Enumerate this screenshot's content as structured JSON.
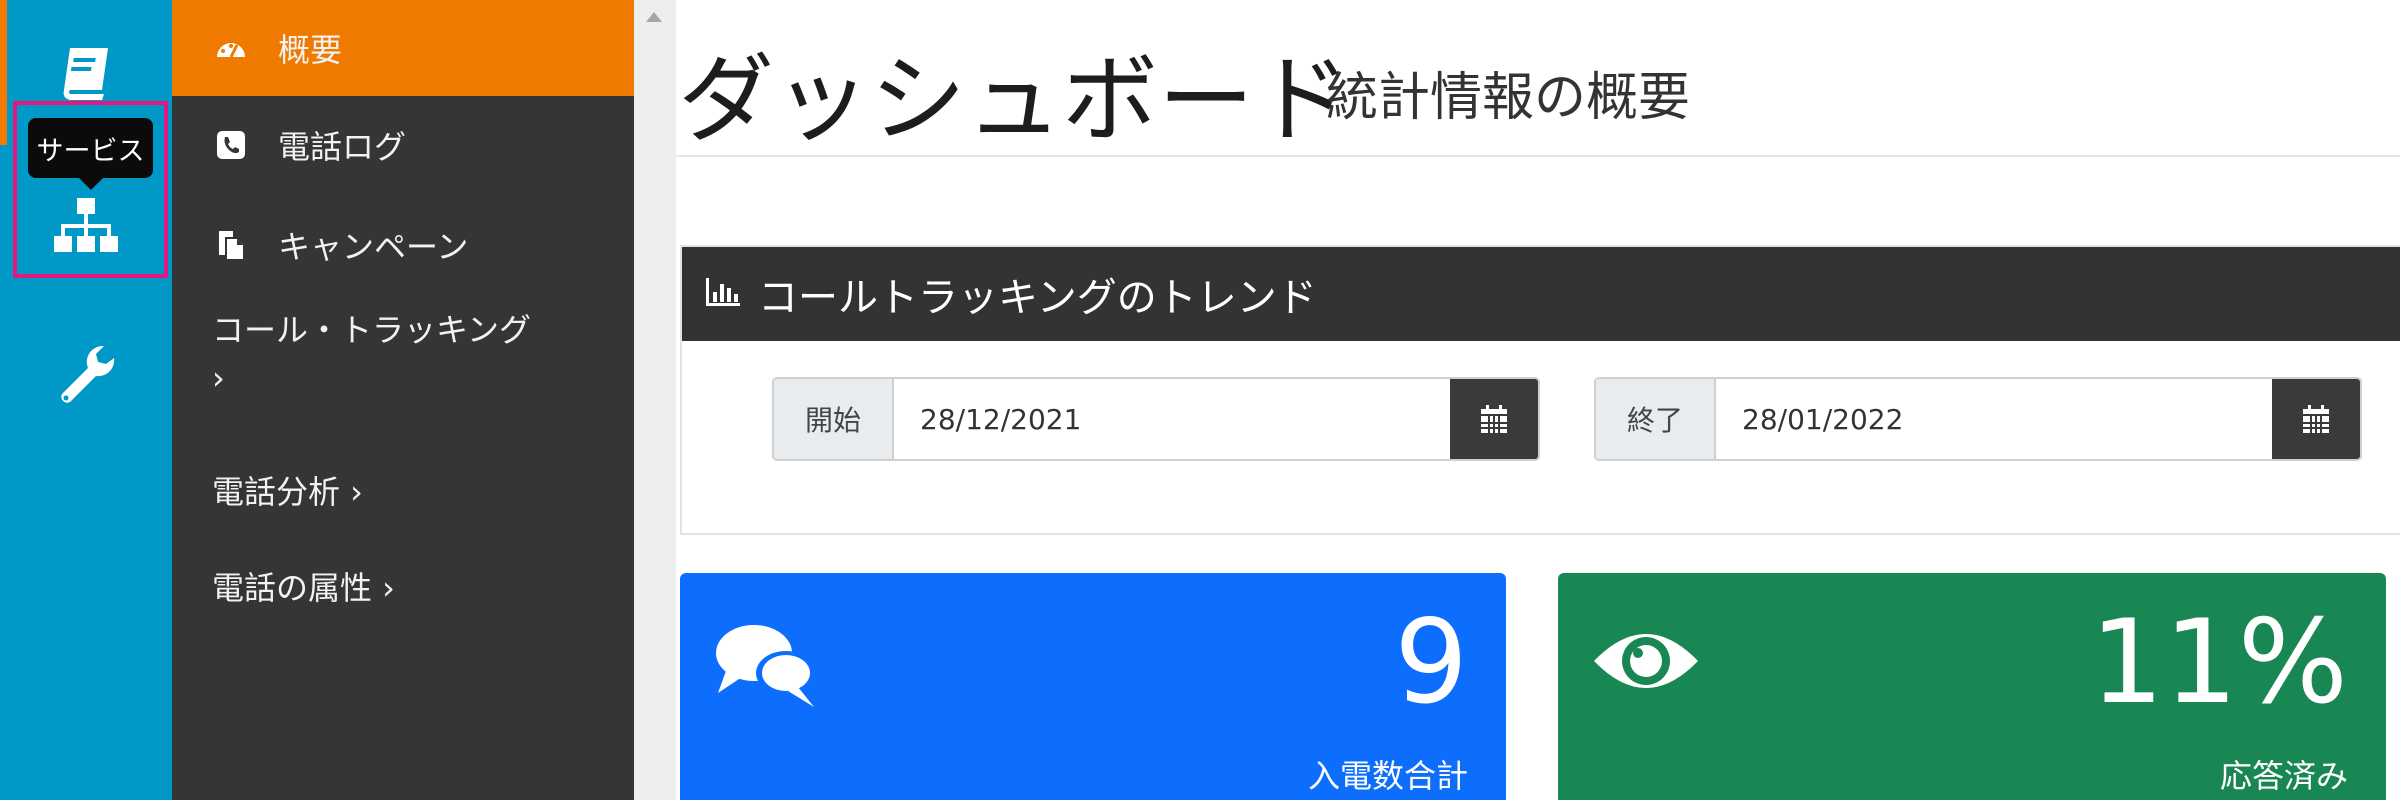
{
  "rail": {
    "tooltip": "サービス"
  },
  "menu": {
    "items": [
      {
        "label": "概要"
      },
      {
        "label": "電話ログ"
      },
      {
        "label": "キャンペーン"
      },
      {
        "label_line1": "コール・トラッキング",
        "label_line2": "›"
      },
      {
        "label": "電話分析 ›"
      },
      {
        "label": "電話の属性 ›"
      }
    ]
  },
  "header": {
    "title": "ダッシュボード",
    "subtitle": "統計情報の概要"
  },
  "trend_panel": {
    "title": "コールトラッキングのトレンド",
    "start_label": "開始",
    "start_value": "28/12/2021",
    "end_label": "終了",
    "end_value": "28/01/2022"
  },
  "stats": {
    "calls": {
      "value": "9",
      "label": "入電数合計",
      "color": "#0d6efd"
    },
    "answered": {
      "value": "11%",
      "label": "応答済み",
      "color": "#198754"
    }
  },
  "colors": {
    "rail": "#0099c7",
    "menu": "#353535",
    "active": "#f07a00",
    "highlight": "#e6167f"
  }
}
